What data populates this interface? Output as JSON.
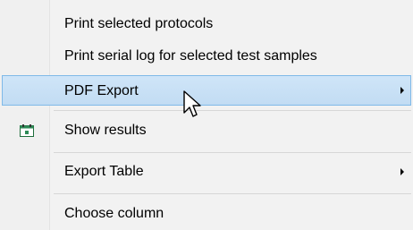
{
  "menu": {
    "items": [
      {
        "label": "Print selected protocols",
        "has_submenu": false,
        "icon": null
      },
      {
        "label": "Print serial log for selected test samples",
        "has_submenu": false,
        "icon": null
      },
      {
        "label": "PDF Export",
        "has_submenu": true,
        "icon": null,
        "highlighted": true
      },
      {
        "label": "Show results",
        "has_submenu": false,
        "icon": "calendar-icon"
      },
      {
        "label": "Export Table",
        "has_submenu": true,
        "icon": null
      },
      {
        "label": "Choose column",
        "has_submenu": false,
        "icon": null
      }
    ]
  },
  "colors": {
    "highlight_fill": "#cce4f7",
    "highlight_border": "#7fb9e8",
    "calendar_green": "#2e8b57"
  },
  "cursor": "arrow-pointer-icon"
}
